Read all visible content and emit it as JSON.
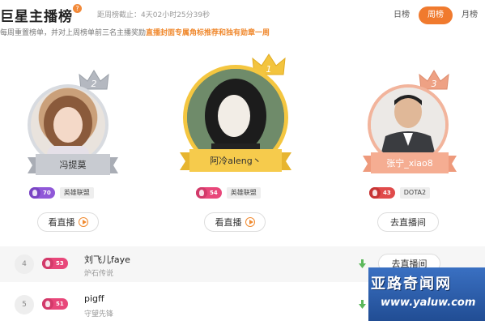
{
  "header": {
    "title": "巨星主播榜",
    "countdown_label": "距周榜截止：",
    "countdown_value": "4天02小时25分39秒",
    "notice_prefix": "每周重置榜单，并对上周榜单前三名主播奖励",
    "notice_highlight": "直播封面专属角标推荐和独有勋章一周"
  },
  "tabs": [
    {
      "label": "日榜",
      "active": false
    },
    {
      "label": "周榜",
      "active": true
    },
    {
      "label": "月榜",
      "active": false
    }
  ],
  "podium": [
    {
      "rank": "2",
      "name": "冯提莫",
      "level": "70",
      "game": "英雄联盟",
      "button": "看直播",
      "ribbon_color": "#b9bcc4",
      "crown_color": "#aeb2ba"
    },
    {
      "rank": "1",
      "name": "阿冷aleng丶",
      "level": "54",
      "game": "英雄联盟",
      "button": "看直播",
      "ribbon_color": "#f5c94a",
      "crown_color": "#f2c23b"
    },
    {
      "rank": "3",
      "name": "张宁_xiao8",
      "level": "43",
      "game": "DOTA2",
      "button": "去直播间",
      "ribbon_color": "#f4a58a",
      "crown_color": "#eea184"
    }
  ],
  "list": [
    {
      "rank": "4",
      "name": "刘飞儿faye",
      "level": "53",
      "game": "炉石传说",
      "button": "去直播间"
    },
    {
      "rank": "5",
      "name": "pigff",
      "level": "51",
      "game": "守望先锋",
      "button": ""
    }
  ],
  "watermark": {
    "cn": "亚路奇闻网",
    "url": "www.yaluw.com"
  },
  "colors": {
    "accent": "#f07a2e",
    "level_pink": "#e8477a",
    "trend_green": "#5cb85c"
  },
  "icons": [
    "question-icon",
    "crown-icon",
    "play-icon",
    "level-badge-icon",
    "trend-down-icon"
  ]
}
